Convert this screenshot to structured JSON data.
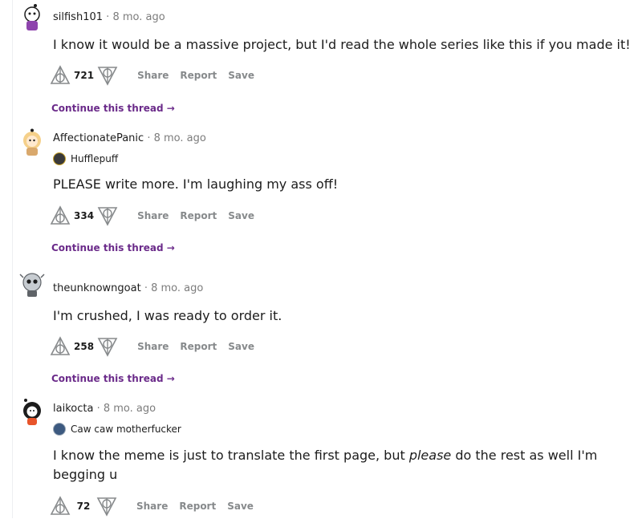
{
  "comments": [
    {
      "author": "silfish101",
      "age": "8 mo. ago",
      "body": "I know it would be a massive project, but I'd read the whole series like this if you made it!",
      "score": "721",
      "share": "Share",
      "report": "Report",
      "save": "Save",
      "continue": "Continue this thread →"
    },
    {
      "author": "AffectionatePanic",
      "age": "8 mo. ago",
      "flair": "Hufflepuff",
      "body": "PLEASE write more. I'm laughing my ass off!",
      "score": "334",
      "share": "Share",
      "report": "Report",
      "save": "Save",
      "continue": "Continue this thread →"
    },
    {
      "author": "theunknowngoat",
      "age": "8 mo. ago",
      "body": "I'm crushed, I was ready to order it.",
      "score": "258",
      "share": "Share",
      "report": "Report",
      "save": "Save",
      "continue": "Continue this thread →"
    },
    {
      "author": "laikocta",
      "age": "8 mo. ago",
      "flair": "Caw caw motherfucker",
      "body_pre": "I know the meme is just to translate the first page, but ",
      "body_em": "please",
      "body_post": " do the rest as well I'm begging u",
      "score": "72",
      "share": "Share",
      "report": "Report",
      "save": "Save"
    }
  ],
  "icons": {
    "upvote": "deathly-hallows-upvote-icon",
    "downvote": "deathly-hallows-downvote-icon"
  },
  "colors": {
    "continue": "#6b2b8a",
    "action": "#878a8c",
    "meta": "#7c7c7c"
  }
}
